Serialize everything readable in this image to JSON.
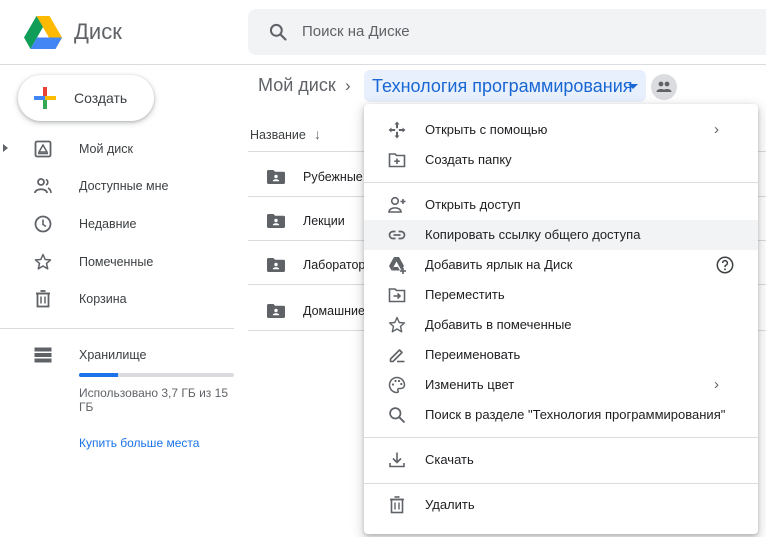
{
  "app": {
    "title": "Диск"
  },
  "search": {
    "placeholder": "Поиск на Диске"
  },
  "sidebar": {
    "create_label": "Создать",
    "items": [
      {
        "label": "Мой диск",
        "icon": "my-drive-icon"
      },
      {
        "label": "Доступные мне",
        "icon": "shared-with-me-icon"
      },
      {
        "label": "Недавние",
        "icon": "recent-clock-icon"
      },
      {
        "label": "Помеченные",
        "icon": "star-icon"
      },
      {
        "label": "Корзина",
        "icon": "trash-icon"
      }
    ],
    "storage": {
      "label": "Хранилище",
      "usage_text": "Использовано 3,7 ГБ из 15 ГБ",
      "used_fraction": 0.25,
      "buy_label": "Купить больше места"
    }
  },
  "breadcrumb": {
    "root": "Мой диск",
    "separator": "›",
    "current": "Технология программирования"
  },
  "file_list": {
    "column_name": "Название",
    "sort_direction": "descending",
    "rows": [
      {
        "name": "Рубежные"
      },
      {
        "name": "Лекции"
      },
      {
        "name": "Лаборатор"
      },
      {
        "name": "Домашние"
      }
    ]
  },
  "context_menu": {
    "items": [
      {
        "label": "Открыть с помощью",
        "icon": "open-with-icon",
        "submenu": true
      },
      {
        "label": "Создать папку",
        "icon": "new-folder-icon"
      },
      {
        "label": "Открыть доступ",
        "icon": "share-person-icon"
      },
      {
        "label": "Копировать ссылку общего доступа",
        "icon": "link-icon",
        "highlighted": true
      },
      {
        "label": "Добавить ярлык на Диск",
        "icon": "add-shortcut-icon",
        "help": true
      },
      {
        "label": "Переместить",
        "icon": "move-icon"
      },
      {
        "label": "Добавить в помеченные",
        "icon": "star-icon"
      },
      {
        "label": "Переименовать",
        "icon": "rename-pencil-icon"
      },
      {
        "label": "Изменить цвет",
        "icon": "palette-icon",
        "submenu": true
      },
      {
        "label": "Поиск в разделе \"Технология программирования\"",
        "icon": "search-icon"
      },
      {
        "label": "Скачать",
        "icon": "download-icon"
      },
      {
        "label": "Удалить",
        "icon": "trash-icon"
      }
    ]
  },
  "colors": {
    "accent_blue": "#1a73e8",
    "breadcrumb_highlight": "#e8f0fe",
    "menu_hover": "#f1f3f4"
  }
}
